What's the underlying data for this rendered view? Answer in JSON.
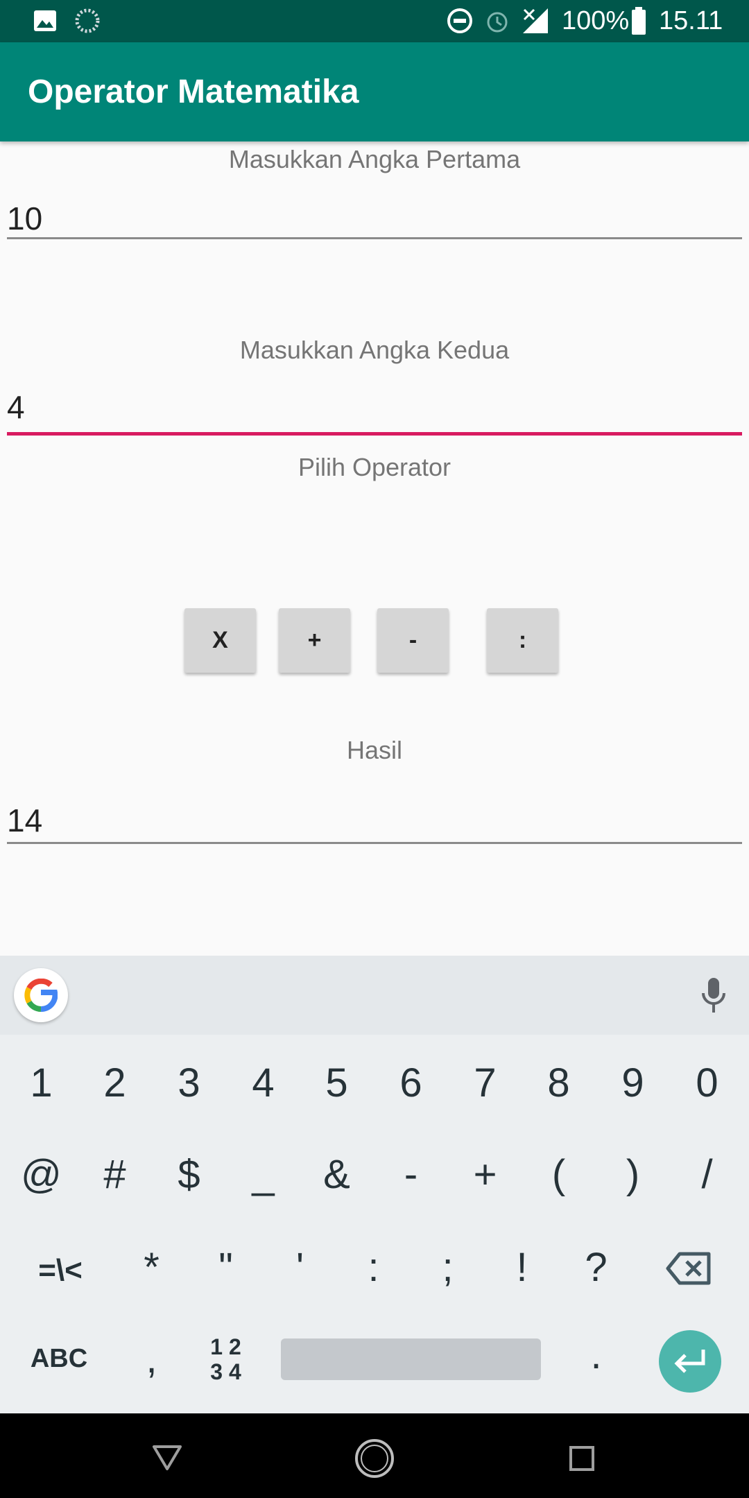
{
  "status_bar": {
    "battery": "100%",
    "time": "15.11",
    "icons": [
      "image-icon",
      "loading-icon",
      "dnd-icon",
      "alarm-icon",
      "signal-icon",
      "battery-icon"
    ]
  },
  "app_bar": {
    "title": "Operator Matematika"
  },
  "form": {
    "first_label": "Masukkan Angka Pertama",
    "first_value": "10",
    "second_label": "Masukkan Angka Kedua",
    "second_value": "4",
    "operator_label": "Pilih Operator",
    "operators": [
      "X",
      "+",
      "-",
      ":"
    ],
    "result_label": "Hasil",
    "result_value": "14"
  },
  "keyboard": {
    "row1": [
      "1",
      "2",
      "3",
      "4",
      "5",
      "6",
      "7",
      "8",
      "9",
      "0"
    ],
    "row2": [
      "@",
      "#",
      "$",
      "_",
      "&",
      "-",
      "+",
      "(",
      ")",
      "/"
    ],
    "row3": [
      "=\\<",
      "*",
      "\"",
      "'",
      ":",
      ";",
      "!",
      "?"
    ],
    "abc": "ABC",
    "comma": ",",
    "numpad_top": "1 2",
    "numpad_bottom": "3 4",
    "period": "."
  },
  "colors": {
    "primary": "#008577",
    "primary_dark": "#00574b",
    "accent": "#d81b60",
    "enter": "#4db6ac"
  }
}
